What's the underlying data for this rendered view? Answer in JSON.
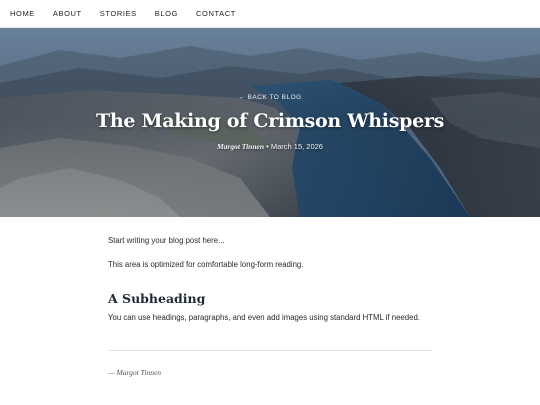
{
  "nav": {
    "items": [
      {
        "label": "HOME"
      },
      {
        "label": "ABOUT"
      },
      {
        "label": "STORIES"
      },
      {
        "label": "BLOG"
      },
      {
        "label": "CONTACT"
      }
    ]
  },
  "hero": {
    "back_link": "← BACK TO BLOG",
    "title": "The Making of Crimson Whispers",
    "author": "Margot Tinnen",
    "separator": "•",
    "date": "March 15, 2026"
  },
  "article": {
    "paragraph_1": "Start writing your blog post here...",
    "paragraph_2": "This area is optimized for comfortable long-form reading.",
    "subheading": "A Subheading",
    "paragraph_3": "You can use headings, paragraphs, and even add images using standard HTML if needed.",
    "signature": "— Margot Tinnen"
  },
  "colors": {
    "hero_water": "#2f5f86",
    "hero_sky": "#7f9bb8",
    "nav_text": "#222222"
  }
}
